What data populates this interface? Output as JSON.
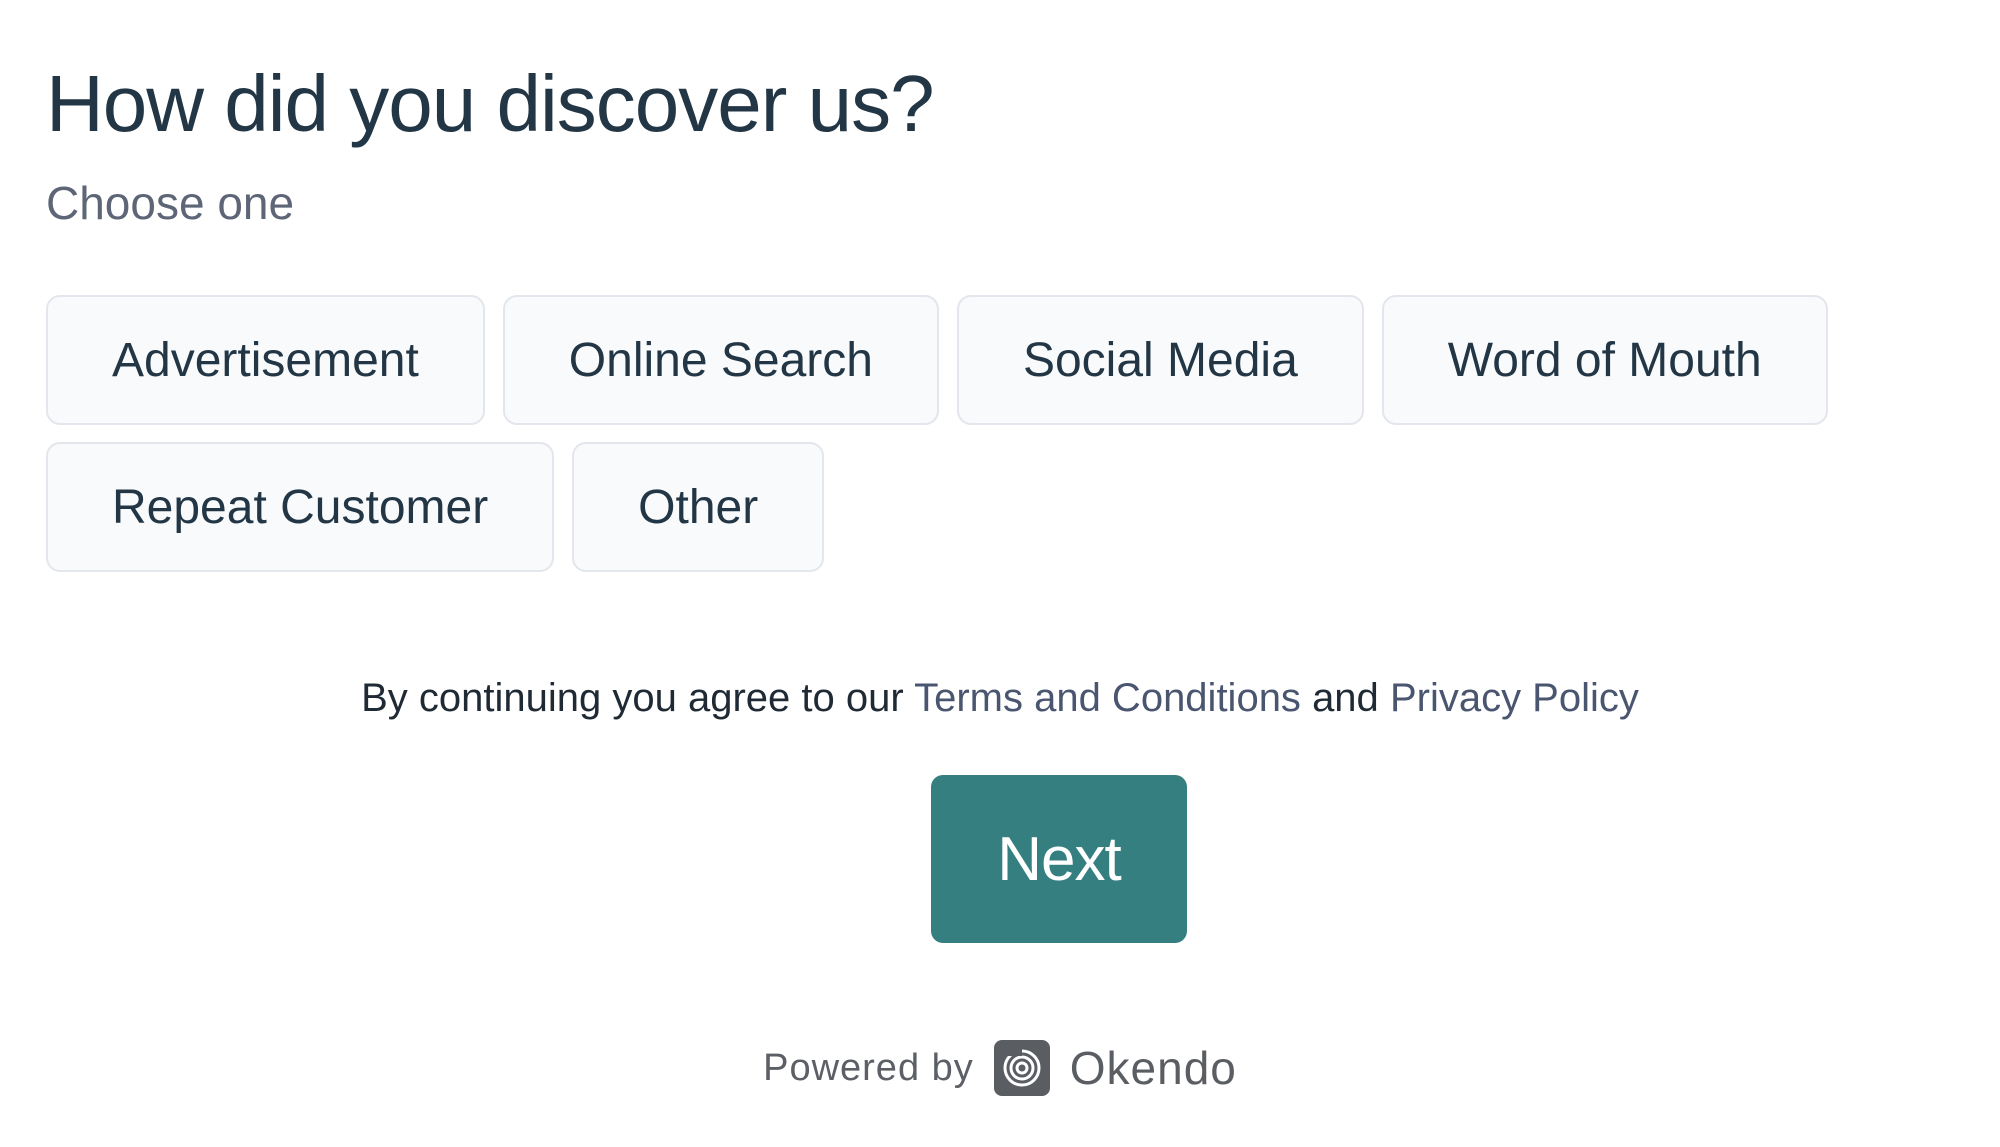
{
  "question": {
    "title": "How did you discover us?",
    "subtitle": "Choose one"
  },
  "options": [
    {
      "label": "Advertisement"
    },
    {
      "label": "Online Search"
    },
    {
      "label": "Social Media"
    },
    {
      "label": "Word of Mouth"
    },
    {
      "label": "Repeat Customer"
    },
    {
      "label": "Other"
    }
  ],
  "legal": {
    "prefix": "By continuing you agree to our",
    "terms_link": "Terms and Conditions",
    "conjunction": "and",
    "privacy_link": "Privacy Policy"
  },
  "next_button": {
    "label": "Next"
  },
  "footer": {
    "powered_by": "Powered by",
    "brand": "Okendo",
    "brand_icon": "okendo-logo-icon"
  },
  "colors": {
    "accent": "#357f81",
    "text": "#233645",
    "muted": "#5d6577"
  }
}
